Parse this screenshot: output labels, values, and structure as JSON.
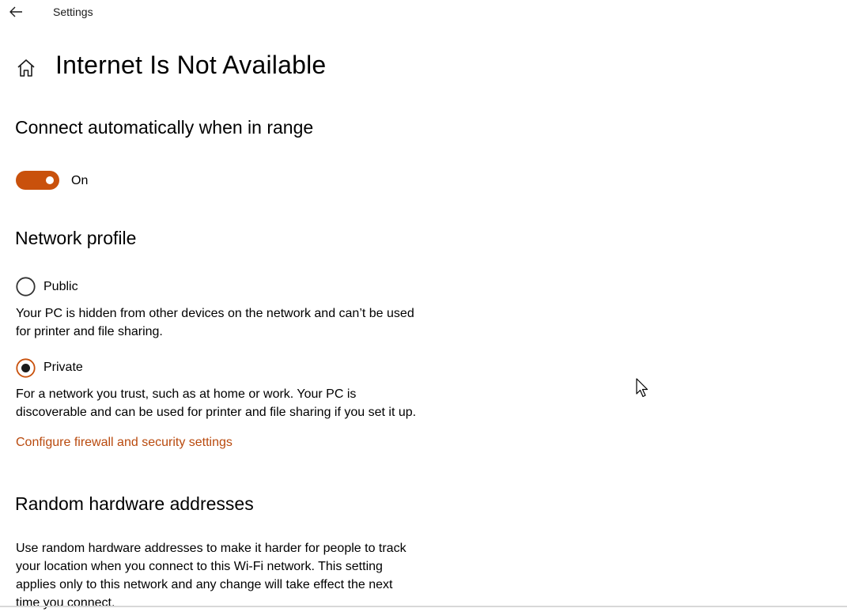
{
  "window": {
    "title": "Settings"
  },
  "page": {
    "title": "Internet Is Not Available"
  },
  "auto_connect": {
    "heading": "Connect automatically when in range",
    "toggle_state": "On",
    "enabled": true
  },
  "network_profile": {
    "heading": "Network profile",
    "options": [
      {
        "label": "Public",
        "selected": false,
        "description": "Your PC is hidden from other devices on the network and can’t be used\nfor printer and file sharing."
      },
      {
        "label": "Private",
        "selected": true,
        "description": "For a network you trust, such as at home or work. Your PC is\ndiscoverable and can be used for printer and file sharing if you set it up."
      }
    ],
    "link": "Configure firewall and security settings"
  },
  "random_hw": {
    "heading": "Random hardware addresses",
    "description": "Use random hardware addresses to make it harder for people to track\nyour location when you connect to this Wi-Fi network. This setting\napplies only to this network and any change will take effect the next\ntime you connect."
  },
  "icons": {
    "back": "back-arrow-icon",
    "home": "home-icon",
    "cursor": "mouse-pointer-icon"
  },
  "colors": {
    "accent": "#C9510C",
    "link": "#B94A0E",
    "radio_border": "#333333"
  }
}
